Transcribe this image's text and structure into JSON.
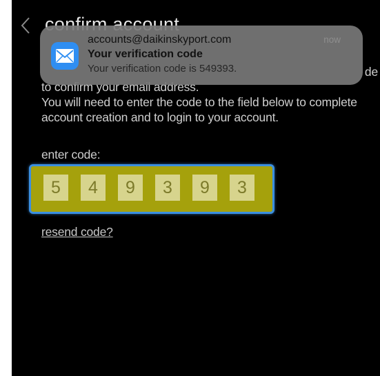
{
  "header": {
    "title": "confirm account",
    "back_icon": "chevron-left-icon"
  },
  "instructions": {
    "line1_tail": "de",
    "line2": "to confirm your email address.",
    "line3": "You will need to enter the code to the field below to complete",
    "line4": "account creation and to login to your account."
  },
  "code_entry": {
    "label": "enter code:",
    "digits": [
      "5",
      "4",
      "9",
      "3",
      "9",
      "3"
    ],
    "colors": {
      "field_fill": "#a5a10c",
      "field_border": "#3b8fe0",
      "digit_fill": "#d7d48d"
    }
  },
  "resend_link": "resend code?",
  "notification": {
    "app_icon": "mail-icon",
    "sender": "accounts@daikinskyport.com",
    "time": "now",
    "subject": "Your verification code",
    "preview": "Your verification code is 549393."
  }
}
